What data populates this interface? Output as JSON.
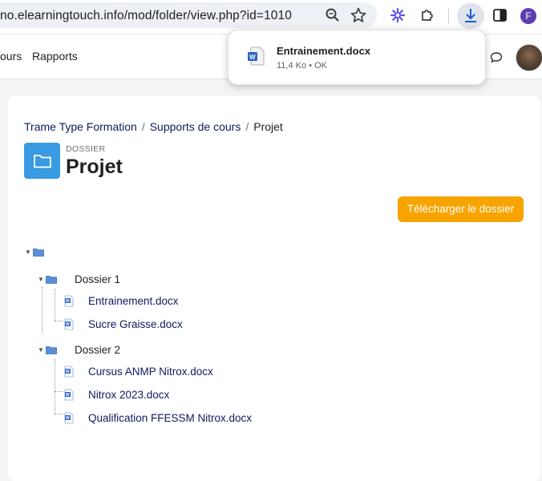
{
  "browser": {
    "url": "no.elearningtouch.info/mod/folder/view.php?id=1010",
    "profile_initial": "F"
  },
  "nav": {
    "items": [
      "ours",
      "Rapports"
    ]
  },
  "download_popup": {
    "filename": "Entrainement.docx",
    "meta": "11,4 Ko • OK"
  },
  "breadcrumb": {
    "items": [
      "Trame Type Formation",
      "Supports de cours"
    ],
    "current": "Projet",
    "separator": "/"
  },
  "header": {
    "kind": "DOSSIER",
    "title": "Projet"
  },
  "actions": {
    "download_folder": "Télécharger le dossier"
  },
  "tree": {
    "folders": [
      {
        "name": "Dossier 1",
        "files": [
          "Entrainement.docx",
          "Sucre Graisse.docx"
        ]
      },
      {
        "name": "Dossier 2",
        "files": [
          "Cursus ANMP Nitrox.docx",
          "Nitrox 2023.docx",
          "Qualification FFESSM Nitrox.docx"
        ]
      }
    ]
  },
  "colors": {
    "accent_orange": "#f7a400",
    "folder_blue": "#399be2",
    "link_navy": "#0f1a5c"
  }
}
